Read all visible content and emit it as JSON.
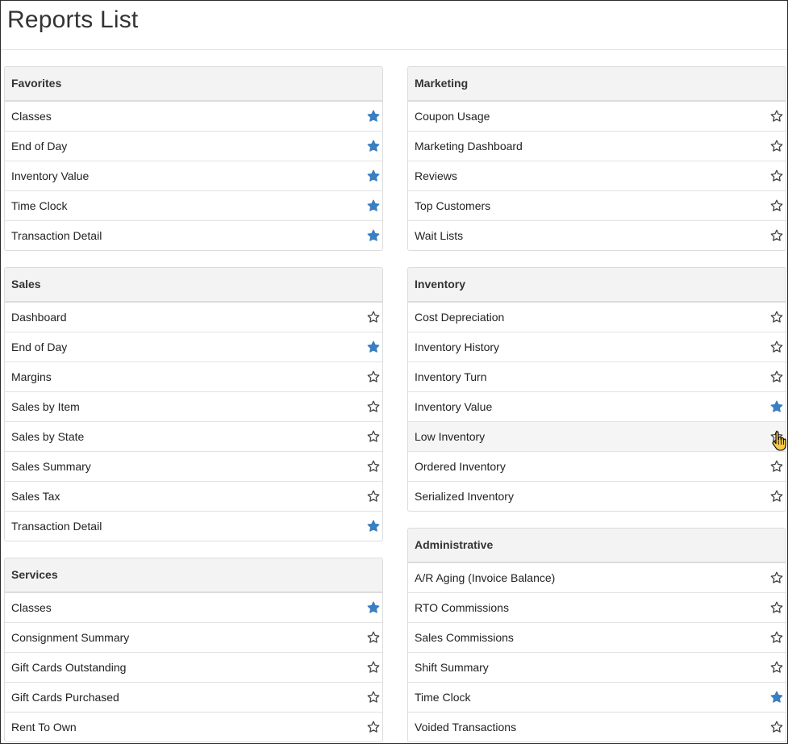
{
  "page": {
    "title": "Reports List"
  },
  "colors": {
    "star_filled": "#3a7fc0",
    "star_outline": "#444444"
  },
  "columns": {
    "left": [
      {
        "heading": "Favorites",
        "items": [
          {
            "label": "Classes",
            "favorite": true
          },
          {
            "label": "End of Day",
            "favorite": true
          },
          {
            "label": "Inventory Value",
            "favorite": true
          },
          {
            "label": "Time Clock",
            "favorite": true
          },
          {
            "label": "Transaction Detail",
            "favorite": true
          }
        ]
      },
      {
        "heading": "Sales",
        "items": [
          {
            "label": "Dashboard",
            "favorite": false
          },
          {
            "label": "End of Day",
            "favorite": true
          },
          {
            "label": "Margins",
            "favorite": false
          },
          {
            "label": "Sales by Item",
            "favorite": false
          },
          {
            "label": "Sales by State",
            "favorite": false
          },
          {
            "label": "Sales Summary",
            "favorite": false
          },
          {
            "label": "Sales Tax",
            "favorite": false
          },
          {
            "label": "Transaction Detail",
            "favorite": true
          }
        ]
      },
      {
        "heading": "Services",
        "items": [
          {
            "label": "Classes",
            "favorite": true
          },
          {
            "label": "Consignment Summary",
            "favorite": false
          },
          {
            "label": "Gift Cards Outstanding",
            "favorite": false
          },
          {
            "label": "Gift Cards Purchased",
            "favorite": false
          },
          {
            "label": "Rent To Own",
            "favorite": false
          }
        ]
      }
    ],
    "right": [
      {
        "heading": "Marketing",
        "items": [
          {
            "label": "Coupon Usage",
            "favorite": false
          },
          {
            "label": "Marketing Dashboard",
            "favorite": false
          },
          {
            "label": "Reviews",
            "favorite": false
          },
          {
            "label": "Top Customers",
            "favorite": false
          },
          {
            "label": "Wait Lists",
            "favorite": false
          }
        ]
      },
      {
        "heading": "Inventory",
        "items": [
          {
            "label": "Cost Depreciation",
            "favorite": false
          },
          {
            "label": "Inventory History",
            "favorite": false
          },
          {
            "label": "Inventory Turn",
            "favorite": false
          },
          {
            "label": "Inventory Value",
            "favorite": true
          },
          {
            "label": "Low Inventory",
            "favorite": false,
            "hovered": true
          },
          {
            "label": "Ordered Inventory",
            "favorite": false
          },
          {
            "label": "Serialized Inventory",
            "favorite": false
          }
        ]
      },
      {
        "heading": "Administrative",
        "items": [
          {
            "label": "A/R Aging (Invoice Balance)",
            "favorite": false
          },
          {
            "label": "RTO Commissions",
            "favorite": false
          },
          {
            "label": "Sales Commissions",
            "favorite": false
          },
          {
            "label": "Shift Summary",
            "favorite": false
          },
          {
            "label": "Time Clock",
            "favorite": true
          },
          {
            "label": "Voided Transactions",
            "favorite": false
          }
        ]
      }
    ]
  }
}
